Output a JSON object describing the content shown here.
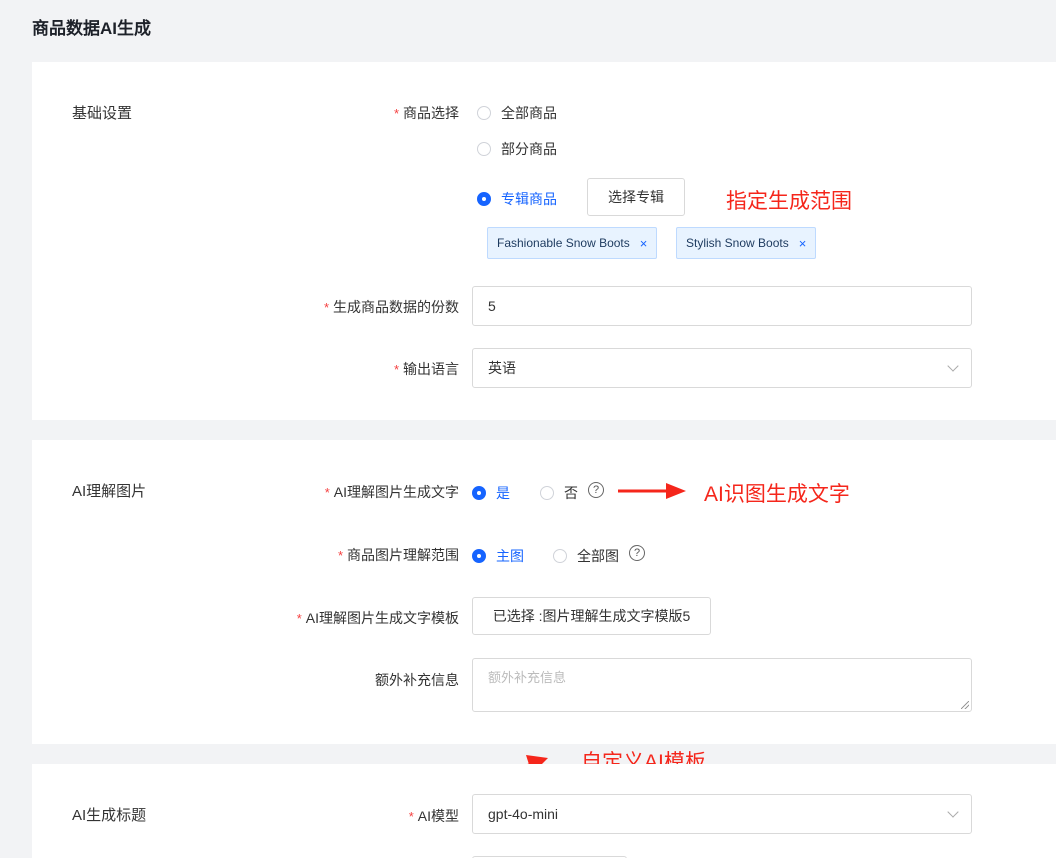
{
  "page_title": "商品数据AI生成",
  "basic": {
    "section_title": "基础设置",
    "product_select_label": "商品选择",
    "options": [
      "全部商品",
      "部分商品",
      "专辑商品"
    ],
    "selected_option": "专辑商品",
    "select_album_button": "选择专辑",
    "tags": [
      "Fashionable Snow Boots",
      "Stylish Snow Boots"
    ],
    "tag_close": "×",
    "copies_label": "生成商品数据的份数",
    "copies_value": "5",
    "language_label": "输出语言",
    "language_value": "英语"
  },
  "ai_image": {
    "section_title": "AI理解图片",
    "gen_text_label": "AI理解图片生成文字",
    "gen_text_options": [
      "是",
      "否"
    ],
    "gen_text_selected": "是",
    "scope_label": "商品图片理解范围",
    "scope_options": [
      "主图",
      "全部图"
    ],
    "scope_selected": "主图",
    "template_label": "AI理解图片生成文字模板",
    "template_button": "已选择 :图片理解生成文字模版5",
    "extra_label": "额外补充信息",
    "extra_placeholder": "额外补充信息",
    "help_glyph": "?"
  },
  "ai_title": {
    "section_title": "AI生成标题",
    "model_label": "AI模型",
    "model_value": "gpt-4o-mini"
  },
  "required_mark": "*",
  "annotations": {
    "range": "指定生成范围",
    "image_to_text": "AI识图生成文字",
    "custom_template": "自定义AI模板"
  },
  "colors": {
    "accent": "#1664ff",
    "annotation": "#f5261b",
    "required": "#f53f3f"
  }
}
